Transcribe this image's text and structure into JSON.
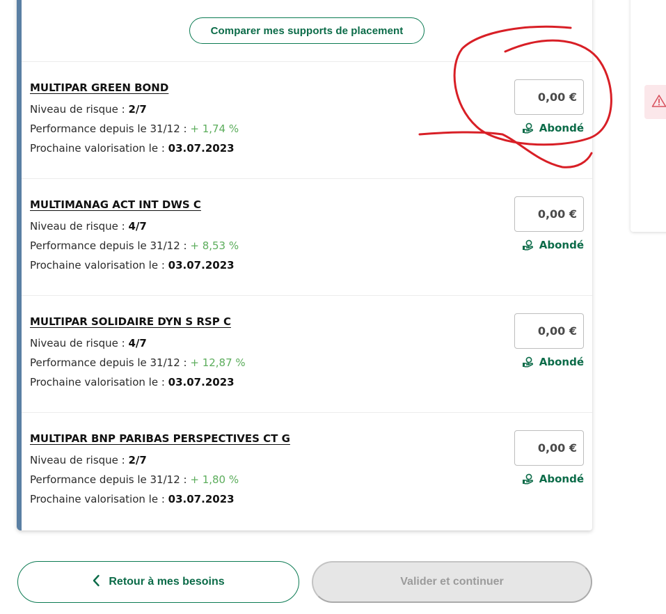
{
  "compare_button": "Comparer mes supports de placement",
  "labels": {
    "risk": "Niveau de risque :",
    "performance": "Performance depuis le 31/12 :",
    "valuation": "Prochaine valorisation le :"
  },
  "funds": [
    {
      "name": "MULTIPAR GREEN BOND",
      "risk": "2/7",
      "performance": "+ 1,74 %",
      "valuation_date": "03.07.2023",
      "amount": "0,00 €",
      "badge": "Abondé"
    },
    {
      "name": "MULTIMANAG ACT INT DWS C",
      "risk": "4/7",
      "performance": "+ 8,53 %",
      "valuation_date": "03.07.2023",
      "amount": "0,00 €",
      "badge": "Abondé"
    },
    {
      "name": "MULTIPAR SOLIDAIRE DYN S RSP C",
      "risk": "4/7",
      "performance": "+ 12,87 %",
      "valuation_date": "03.07.2023",
      "amount": "0,00 €",
      "badge": "Abondé"
    },
    {
      "name": "MULTIPAR BNP PARIBAS PERSPECTIVES CT G",
      "risk": "2/7",
      "performance": "+ 1,80 %",
      "valuation_date": "03.07.2023",
      "amount": "0,00 €",
      "badge": "Abondé"
    }
  ],
  "footer": {
    "back_label": "Retour à mes besoins",
    "next_label": "Valider et continuer"
  },
  "colors": {
    "brand_green": "#0b6b48",
    "performance_green": "#5cad5c",
    "card_accent": "#5a7fa3",
    "annotation_red": "#d81f26"
  },
  "icons": {
    "abonde": "hand-coin-icon",
    "back": "chevron-left-icon",
    "warning": "warning-triangle-icon"
  }
}
